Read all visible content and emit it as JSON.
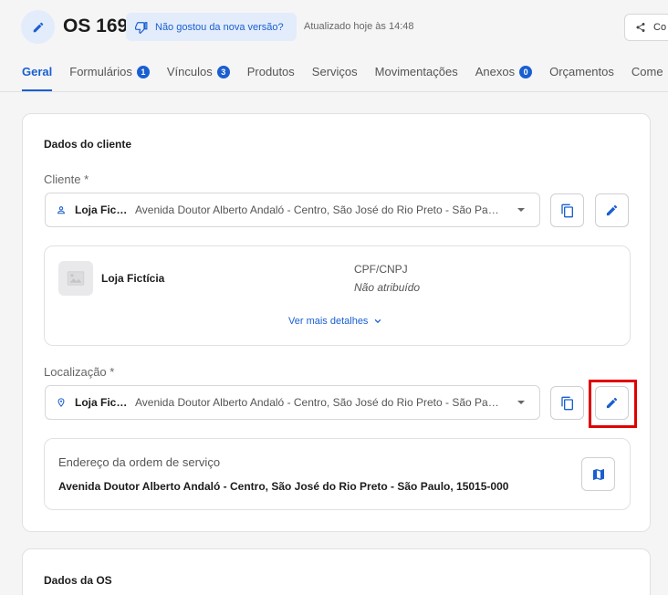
{
  "header": {
    "title": "OS 169",
    "feedback_label": "Não gostou da nova versão?",
    "updated_text": "Atualizado hoje às 14:48",
    "share_label": "Co"
  },
  "tabs": [
    {
      "label": "Geral",
      "active": true
    },
    {
      "label": "Formulários",
      "badge": "1"
    },
    {
      "label": "Vínculos",
      "badge": "3"
    },
    {
      "label": "Produtos"
    },
    {
      "label": "Serviços"
    },
    {
      "label": "Movimentações"
    },
    {
      "label": "Anexos",
      "badge": "0"
    },
    {
      "label": "Orçamentos"
    },
    {
      "label": "Come"
    }
  ],
  "client_section": {
    "title": "Dados do cliente",
    "client_label": "Cliente *",
    "client_select": {
      "name": "Loja Fictícia",
      "address": "Avenida Doutor Alberto Andaló - Centro, São José do Rio Preto - São Paulo"
    },
    "client_card": {
      "name": "Loja Fictícia",
      "doc_label": "CPF/CNPJ",
      "doc_value": "Não atribuído",
      "see_more": "Ver mais detalhes"
    },
    "location_label": "Localização *",
    "location_select": {
      "name": "Loja Fictícia",
      "address": "Avenida Doutor Alberto Andaló - Centro, São José do Rio Preto - São Paulo"
    },
    "address_card": {
      "label": "Endereço da ordem de serviço",
      "value": "Avenida Doutor Alberto Andaló - Centro, São José do Rio Preto - São Paulo, 15015-000"
    }
  },
  "os_section": {
    "title": "Dados da OS"
  },
  "colors": {
    "accent": "#1a5fd0",
    "highlight": "#e00000"
  }
}
